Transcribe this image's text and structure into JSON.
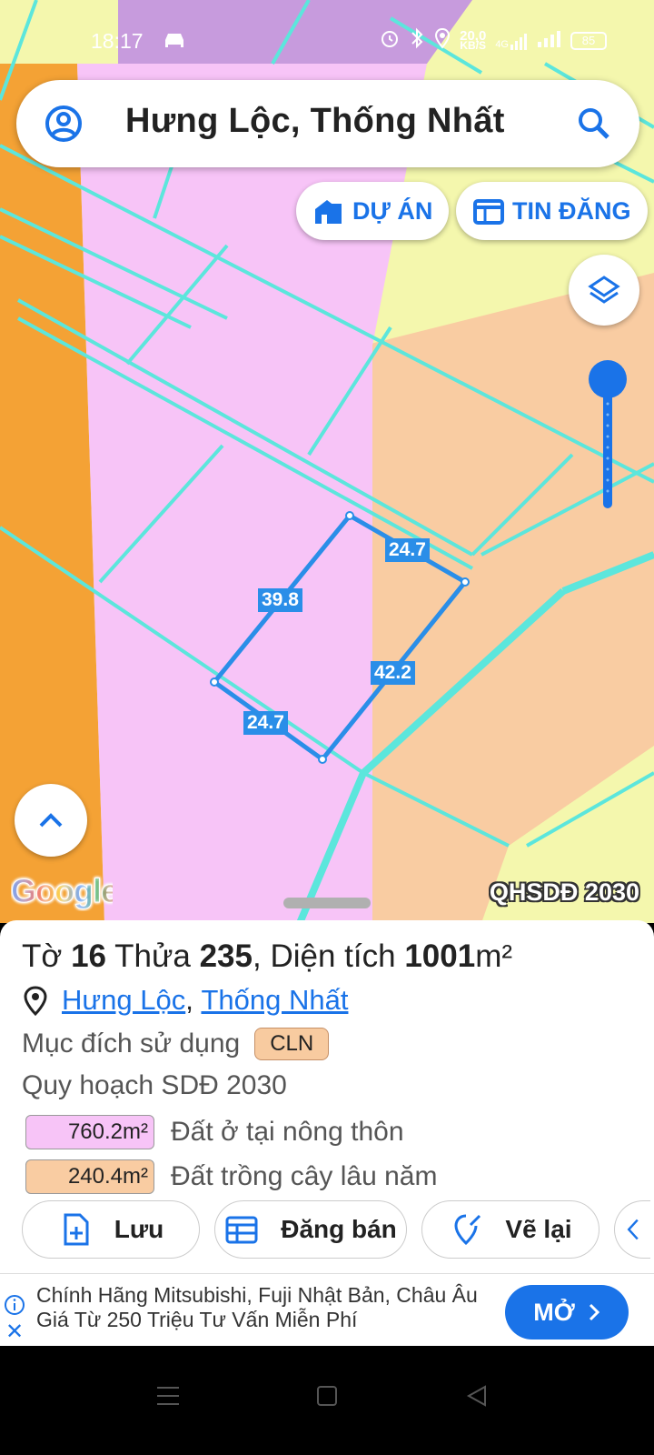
{
  "status_bar": {
    "time": "18:17",
    "net_speed_value": "20,0",
    "net_speed_unit": "KB/S",
    "network_type": "4G",
    "battery": "85"
  },
  "search": {
    "text": "Hưng Lộc, Thống Nhất"
  },
  "chips": {
    "project": "DỰ ÁN",
    "listing": "TIN ĐĂNG"
  },
  "map": {
    "segment_labels": [
      "24.7",
      "39.8",
      "42.2",
      "24.7"
    ],
    "google_logo": "Google",
    "layer_label": "QHSDĐ 2030",
    "colors": {
      "pink": "#f7c4f7",
      "orange": "#f4a235",
      "peach": "#f9cca2",
      "yellow": "#f4f7ad",
      "purple": "#c79bdd",
      "line": "#5ce6dc",
      "parcel": "#2a8ee8"
    }
  },
  "parcel": {
    "sheet_label": "Tờ",
    "sheet": "16",
    "lot_label": "Thửa",
    "lot": "235",
    "area_label": "Diện tích",
    "area": "1001",
    "area_unit": "m²",
    "location_ward": "Hưng Lộc",
    "location_district": "Thống Nhất",
    "purpose_label": "Mục đích sử dụng",
    "purpose_code": "CLN",
    "plan_label": "Quy hoạch SDĐ 2030",
    "zones": [
      {
        "value": "760.2m²",
        "label": "Đất ở tại nông thôn",
        "color": "#f7c4f7"
      },
      {
        "value": "240.4m²",
        "label": "Đất trồng cây lâu năm",
        "color": "#f9cca2"
      }
    ]
  },
  "actions": {
    "save": "Lưu",
    "sell": "Đăng bán",
    "redraw": "Vẽ lại"
  },
  "ad": {
    "text": "Chính Hãng Mitsubishi, Fuji Nhật Bản, Châu Âu Giá Từ 250 Triệu Tư Vấn Miễn Phí",
    "button": "MỞ"
  }
}
